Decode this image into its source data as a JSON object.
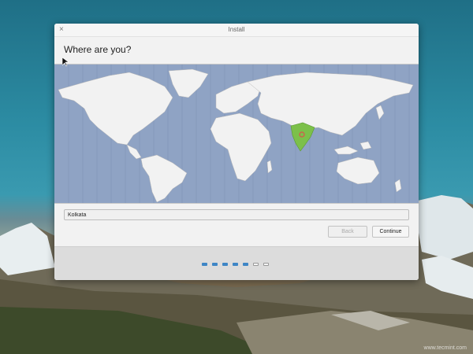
{
  "window": {
    "title": "Install",
    "close_glyph": "×",
    "heading": "Where are you?"
  },
  "location": {
    "value": "Kolkata",
    "selected_region": "India"
  },
  "buttons": {
    "back_label": "Back",
    "continue_label": "Continue",
    "back_enabled": false
  },
  "progress": {
    "steps_completed": 5,
    "steps_total": 7
  },
  "watermark": "www.tecmint.com",
  "colors": {
    "map_sea": "#8fa3c4",
    "land": "#f2f2f2",
    "selected_country": "#7cc04a",
    "marker": "#d9534f",
    "progress_done": "#3e86c6"
  }
}
